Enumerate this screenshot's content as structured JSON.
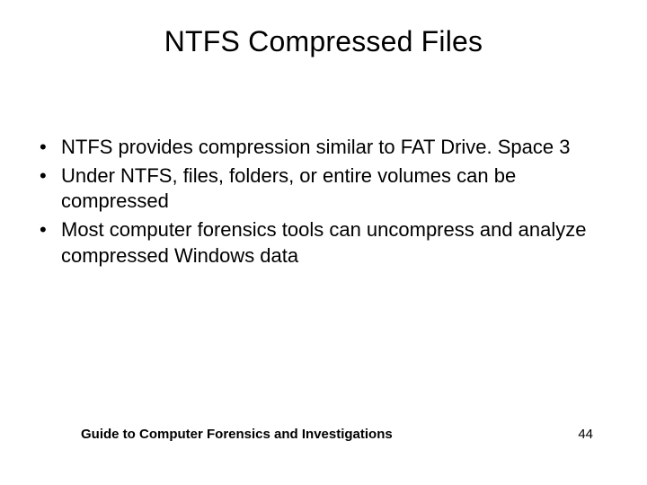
{
  "title": "NTFS Compressed Files",
  "bullets": [
    "NTFS provides compression similar to FAT Drive. Space 3",
    "Under NTFS, files, folders, or entire volumes can be compressed",
    "Most computer forensics tools can uncompress and analyze compressed Windows data"
  ],
  "footer": {
    "text": "Guide to Computer Forensics and Investigations",
    "page": "44"
  }
}
